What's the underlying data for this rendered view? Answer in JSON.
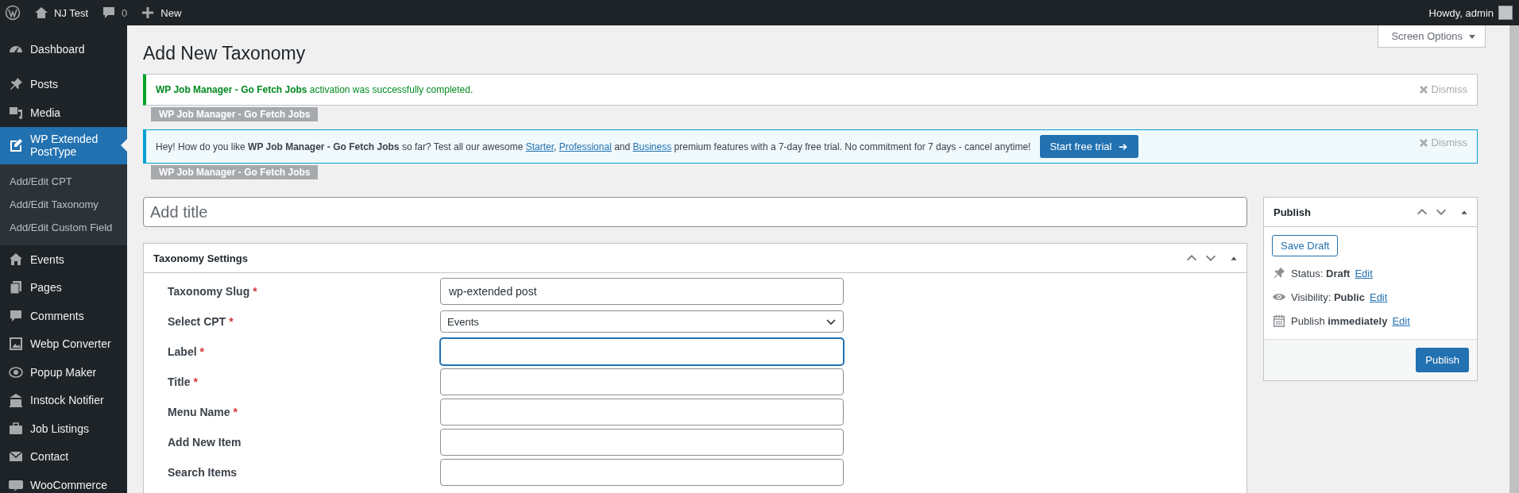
{
  "admin_bar": {
    "site_name": "NJ Test",
    "comments_count": "0",
    "new_label": "New",
    "greeting": "Howdy, admin"
  },
  "sidebar": {
    "items": [
      {
        "label": "Dashboard",
        "selected": false
      },
      {
        "label": "Posts",
        "selected": false
      },
      {
        "label": "Media",
        "selected": false
      },
      {
        "label": "WP Extended PostType",
        "selected": true,
        "children": [
          {
            "label": "Add/Edit CPT",
            "selected": false
          },
          {
            "label": "Add/Edit Taxonomy",
            "selected": false
          },
          {
            "label": "Add/Edit Custom Field",
            "selected": false
          }
        ]
      },
      {
        "label": "Events",
        "selected": false
      },
      {
        "label": "Pages",
        "selected": false
      },
      {
        "label": "Comments",
        "selected": false
      },
      {
        "label": "Webp Converter",
        "selected": false
      },
      {
        "label": "Popup Maker",
        "selected": false
      },
      {
        "label": "Instock Notifier",
        "selected": false
      },
      {
        "label": "Job Listings",
        "selected": false
      },
      {
        "label": "Contact",
        "selected": false
      },
      {
        "label": "WooCommerce",
        "selected": false
      }
    ]
  },
  "screen_options": {
    "label": "Screen Options"
  },
  "page_title": "Add New Taxonomy",
  "notices": [
    {
      "kind": "success",
      "parts": [
        {
          "kind": "text",
          "text": "**WP Job Manager - Go Fetch Jobs** activation was successfully completed."
        }
      ],
      "dismiss": "Dismiss",
      "tag": "WP Job Manager - Go Fetch Jobs"
    },
    {
      "kind": "info",
      "parts": [
        {
          "kind": "text",
          "text": "Hey! How do you like **WP Job Manager - Go Fetch Jobs** so far? Test all our awesome "
        },
        {
          "kind": "link",
          "text": "Starter"
        },
        {
          "kind": "text",
          "text": ", "
        },
        {
          "kind": "link",
          "text": "Professional"
        },
        {
          "kind": "text",
          "text": " and "
        },
        {
          "kind": "link",
          "text": "Business"
        },
        {
          "kind": "text",
          "text": " premium features with a 7-day free trial. No commitment for 7 days - cancel anytime!"
        }
      ],
      "button": "Start free trial",
      "dismiss": "Dismiss",
      "tag": "WP Job Manager - Go Fetch Jobs"
    }
  ],
  "title_field": {
    "placeholder": "Add title"
  },
  "settings_box": {
    "title": "Taxonomy Settings",
    "fields": [
      {
        "label": "Taxonomy Slug",
        "required": "*",
        "kind": "text",
        "value": "wp-extended post",
        "focused": false
      },
      {
        "label": "Select CPT",
        "required": "*",
        "kind": "select",
        "value": "Events",
        "focused": false
      },
      {
        "label": "Label",
        "required": "*",
        "kind": "text",
        "focused": true
      },
      {
        "label": "Title",
        "required": "*",
        "kind": "text",
        "focused": false
      },
      {
        "label": "Menu Name",
        "required": "*",
        "kind": "text",
        "focused": false
      },
      {
        "label": "Add New Item",
        "kind": "text",
        "focused": false
      },
      {
        "label": "Search Items",
        "kind": "text",
        "focused": false
      }
    ]
  },
  "publish_box": {
    "title": "Publish",
    "save_draft": "Save Draft",
    "rows": [
      {
        "text": "Status: **Draft**",
        "link": "Edit"
      },
      {
        "text": "Visibility: **Public**",
        "link": "Edit"
      },
      {
        "text": "Publish **immediately**",
        "link": "Edit"
      }
    ],
    "publish_button": "Publish"
  }
}
